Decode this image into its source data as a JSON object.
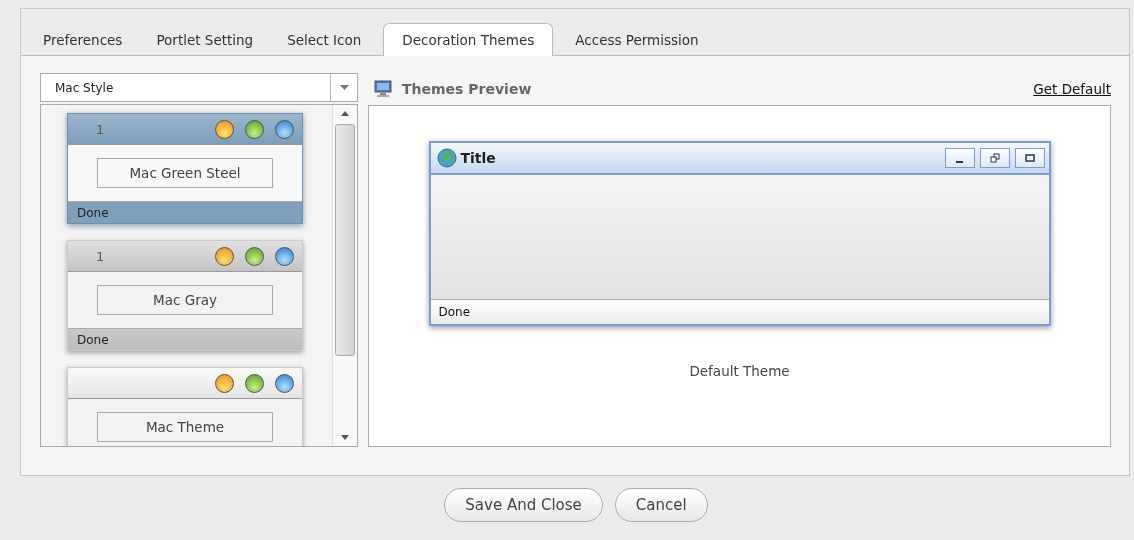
{
  "tabs": [
    {
      "label": "Preferences",
      "selected": false
    },
    {
      "label": "Portlet Setting",
      "selected": false
    },
    {
      "label": "Select Icon",
      "selected": false
    },
    {
      "label": "Decoration Themes",
      "selected": true
    },
    {
      "label": "Access Permission",
      "selected": false
    }
  ],
  "style_select": {
    "value": "Mac Style"
  },
  "themes": [
    {
      "title": "1",
      "name": "Mac Green Steel",
      "status": "Done",
      "selected": true
    },
    {
      "title": "1",
      "name": "Mac Gray",
      "status": "Done",
      "selected": false
    },
    {
      "name": "Mac Theme",
      "selected": false
    }
  ],
  "preview": {
    "heading": "Themes Preview",
    "link": "Get Default",
    "window_title": "Title",
    "window_status": "Done",
    "caption": "Default Theme"
  },
  "buttons": [
    "Save And Close",
    "Cancel"
  ]
}
